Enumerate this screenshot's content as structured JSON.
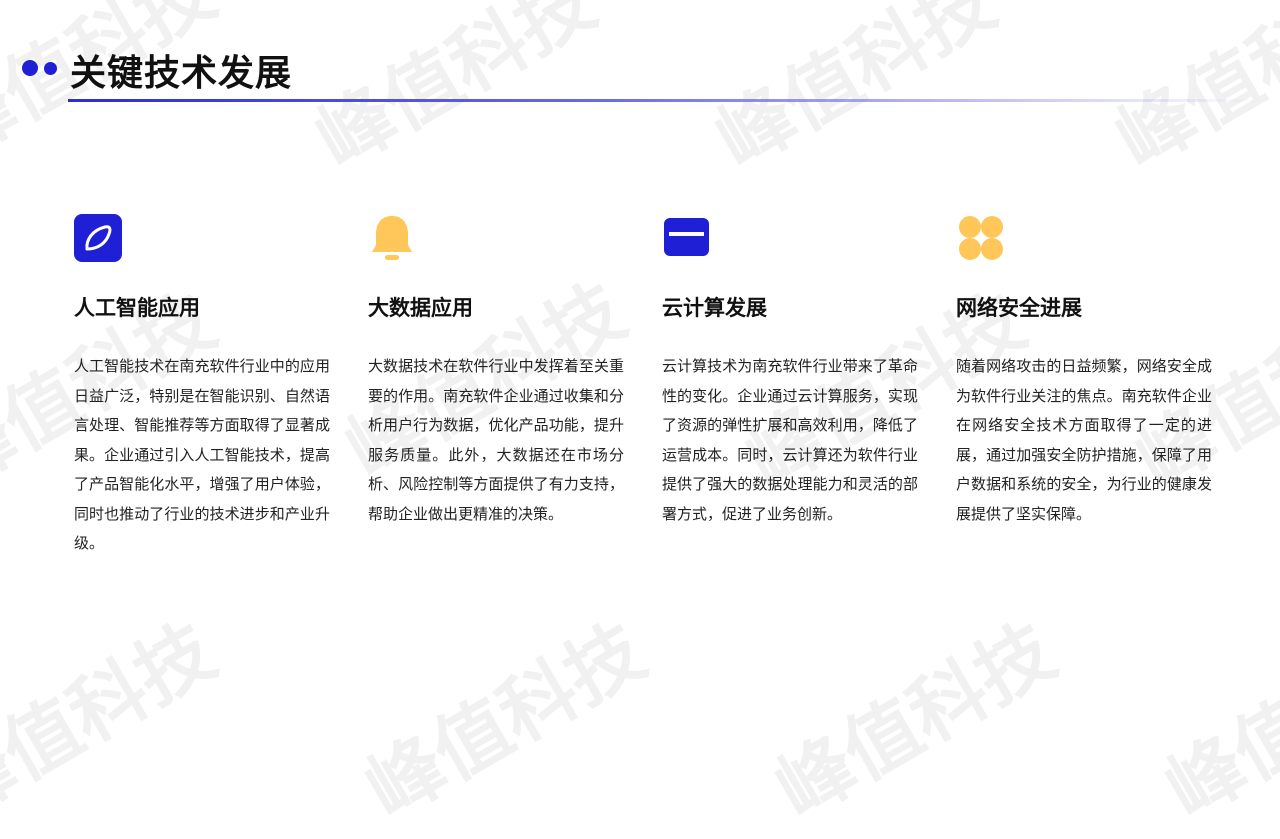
{
  "header": {
    "title": "关键技术发展"
  },
  "watermark": {
    "text": "峰值科技"
  },
  "colors": {
    "accent_blue": "#1f1fd6",
    "accent_yellow": "#ffc65a"
  },
  "cards": [
    {
      "icon": "leaf-icon",
      "title": "人工智能应用",
      "text": "人工智能技术在南充软件行业中的应用日益广泛，特别是在智能识别、自然语言处理、智能推荐等方面取得了显著成果。企业通过引入人工智能技术，提高了产品智能化水平，增强了用户体验，同时也推动了行业的技术进步和产业升级。"
    },
    {
      "icon": "bell-icon",
      "title": "大数据应用",
      "text": "大数据技术在软件行业中发挥着至关重要的作用。南充软件企业通过收集和分析用户行为数据，优化产品功能，提升服务质量。此外，大数据还在市场分析、风险控制等方面提供了有力支持，帮助企业做出更精准的决策。"
    },
    {
      "icon": "card-icon",
      "title": "云计算发展",
      "text": "云计算技术为南充软件行业带来了革命性的变化。企业通过云计算服务，实现了资源的弹性扩展和高效利用，降低了运营成本。同时，云计算还为软件行业提供了强大的数据处理能力和灵活的部署方式，促进了业务创新。"
    },
    {
      "icon": "clover-icon",
      "title": "网络安全进展",
      "text": "随着网络攻击的日益频繁，网络安全成为软件行业关注的焦点。南充软件企业在网络安全技术方面取得了一定的进展，通过加强安全防护措施，保障了用户数据和系统的安全，为行业的健康发展提供了坚实保障。"
    }
  ]
}
